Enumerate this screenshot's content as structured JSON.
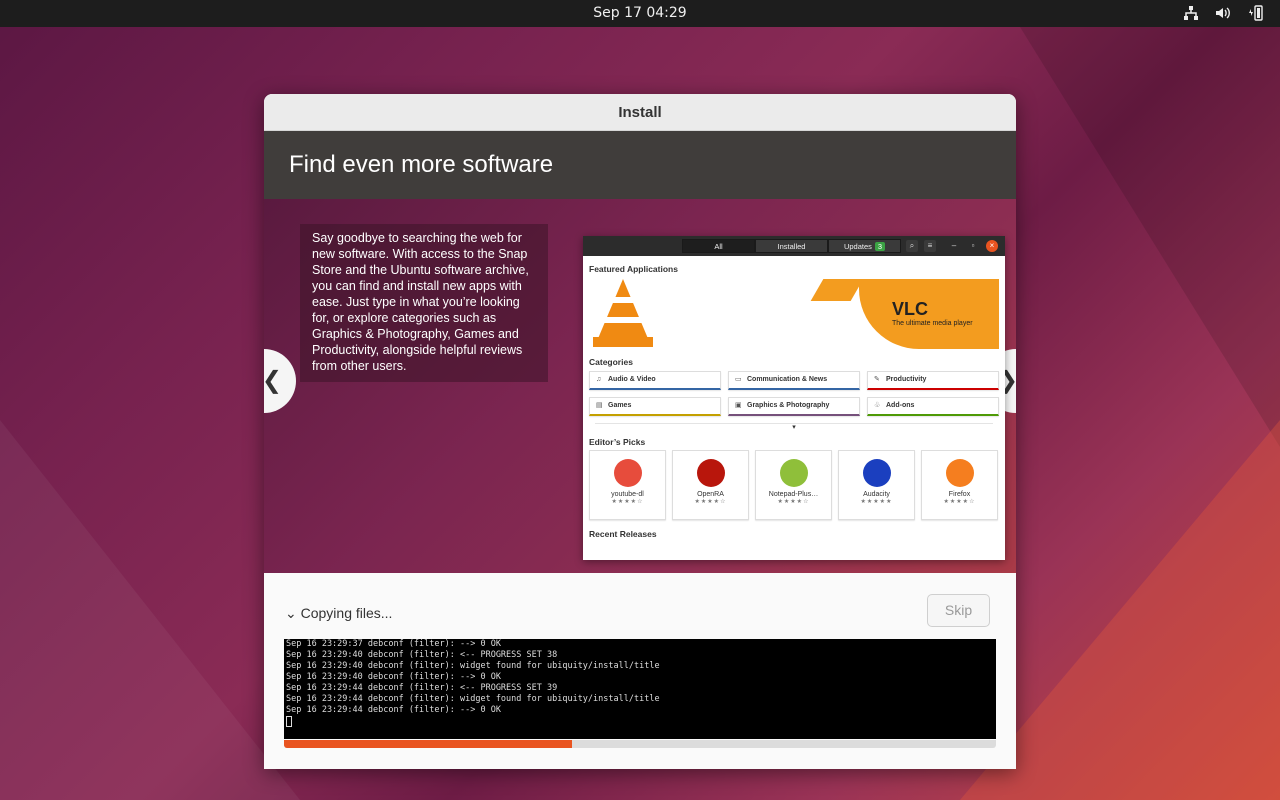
{
  "topbar": {
    "clock": "Sep 17  04:29",
    "tray_icons": [
      "network-icon",
      "volume-icon",
      "battery-icon"
    ]
  },
  "window": {
    "title": "Install",
    "slide": {
      "heading": "Find even more software",
      "body": "Say goodbye to searching the web for new software. With access to the Snap Store and the Ubuntu software archive, you can find and install new apps with ease. Just type in what you’re looking for, or explore categories such as Graphics & Photography, Games and Productivity, alongside helpful reviews from other users.",
      "prev": "❮",
      "next": "❯",
      "screenshot": {
        "tabs": [
          "All",
          "Installed",
          "Updates"
        ],
        "updates_count": "3",
        "featured_heading": "Featured Applications",
        "banner_title": "VLC",
        "banner_subtitle": "The ultimate media player",
        "categories_heading": "Categories",
        "categories": [
          {
            "label": "Audio & Video",
            "color": "#3465a4",
            "icon": "♫"
          },
          {
            "label": "Communication & News",
            "color": "#3465a4",
            "icon": "▭"
          },
          {
            "label": "Productivity",
            "color": "#cc0000",
            "icon": "✎"
          },
          {
            "label": "Games",
            "color": "#c4a000",
            "icon": "▤"
          },
          {
            "label": "Graphics & Photography",
            "color": "#75507b",
            "icon": "▣"
          },
          {
            "label": "Add-ons",
            "color": "#4e9a06",
            "icon": "♧"
          }
        ],
        "picks_heading": "Editor’s Picks",
        "picks": [
          {
            "name": "youtube-dl",
            "stars": "★★★★☆",
            "color": "#e74c3c"
          },
          {
            "name": "OpenRA",
            "stars": "★★★★☆",
            "color": "#b8160c"
          },
          {
            "name": "Notepad-Plus…",
            "stars": "★★★★☆",
            "color": "#8fbf3a"
          },
          {
            "name": "Audacity",
            "stars": "★★★★★",
            "color": "#1b3fbf"
          },
          {
            "name": "Firefox",
            "stars": "★★★★☆",
            "color": "#f57e1f"
          }
        ],
        "recent_heading": "Recent Releases"
      }
    },
    "progress": {
      "label": "Copying files...",
      "skip_label": "Skip",
      "fraction": 0.405,
      "log": [
        "Sep 16 23:29:37 debconf (filter): --> 0 OK",
        "Sep 16 23:29:40 debconf (filter): <-- PROGRESS SET 38",
        "Sep 16 23:29:40 debconf (filter): widget found for ubiquity/install/title",
        "Sep 16 23:29:40 debconf (filter): --> 0 OK",
        "Sep 16 23:29:44 debconf (filter): <-- PROGRESS SET 39",
        "Sep 16 23:29:44 debconf (filter): widget found for ubiquity/install/title",
        "Sep 16 23:29:44 debconf (filter): --> 0 OK"
      ]
    }
  },
  "colors": {
    "accent": "#e95420",
    "header_bg": "#403d3b"
  }
}
